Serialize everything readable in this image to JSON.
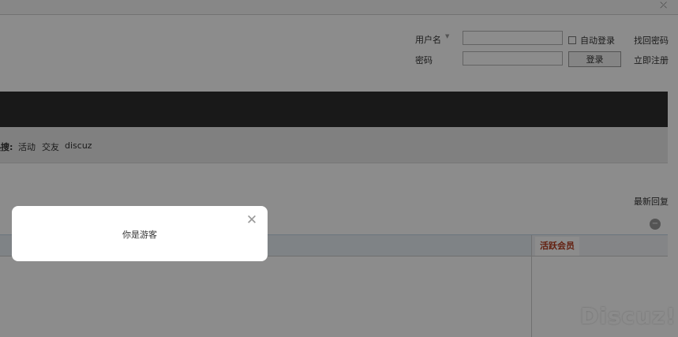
{
  "topbar": {
    "close_icon": "⤫"
  },
  "login": {
    "username_label": "用户名",
    "username_dropdown_icon": "▼",
    "username_value": "",
    "password_label": "密码",
    "password_value": "",
    "auto_login_label": "自动登录",
    "forgot_password": "找回密码",
    "login_button": "登录",
    "register": "立即注册"
  },
  "hot_searches": {
    "label": "热搜:",
    "items": [
      "活动",
      "交友",
      "discuz"
    ]
  },
  "main": {
    "latest_reply": "最新回复",
    "collapse_icon": "−",
    "side_tab": "活跃会员"
  },
  "dialog": {
    "message": "你是游客",
    "close_icon": "✕"
  },
  "watermark": "Discuz!"
}
